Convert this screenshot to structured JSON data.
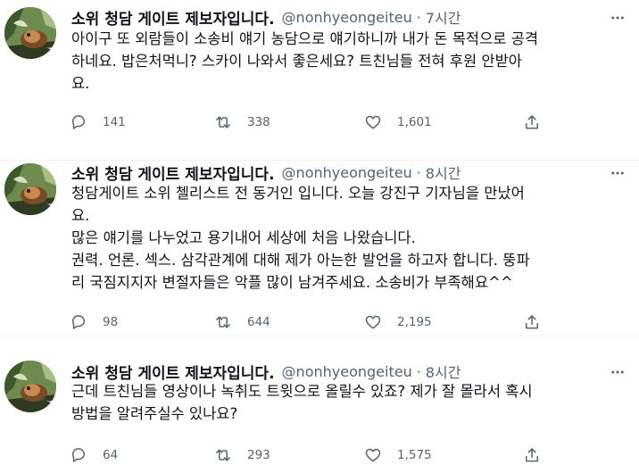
{
  "tweets": [
    {
      "name": "소위 청담 게이트 제보자입니다.",
      "handle": "@nonhyeongeiteu",
      "dot": "·",
      "time": "7시간",
      "lines": [
        "아이구 또 외람들이 소송비 얘기 농담으로 얘기하니까 내가 돈 목적으로 공격",
        "하네요.  밥은처먹니? 스카이 나와서 좋은세요? 트친님들 전혀 후원 안받아",
        "요."
      ],
      "replies": "141",
      "retweets": "338",
      "likes": "1,601"
    },
    {
      "name": "소위 청담 게이트 제보자입니다.",
      "handle": "@nonhyeongeiteu",
      "dot": "·",
      "time": "8시간",
      "lines": [
        "청담게이트 소위 첼리스트 전 동거인 입니다. 오늘 강진구 기자님을 만났어",
        "요.",
        "많은 얘기를 나누었고 용기내어 세상에 처음 나왔습니다.",
        "권력. 언론. 섹스.  삼각관계에 대해 제가 아는한 발언을 하고자 합니다. 뚱파",
        "리 국짐지지자 변절자들은 악플 많이 남겨주세요. 소송비가 부족해요^^"
      ],
      "replies": "98",
      "retweets": "644",
      "likes": "2,195"
    },
    {
      "name": "소위 청담 게이트 제보자입니다.",
      "handle": "@nonhyeongeiteu",
      "dot": "·",
      "time": "8시간",
      "lines": [
        "근데 트친님들 영상이나 녹취도 트윗으로 올릴수 있죠? 제가 잘 몰라서 혹시",
        "방법을 알려주실수 있나요?"
      ],
      "replies": "64",
      "retweets": "293",
      "likes": "1,575"
    }
  ],
  "icons": {
    "reply": "reply-icon",
    "retweet": "retweet-icon",
    "like": "heart-icon",
    "share": "share-icon",
    "more": "more-options-icon"
  },
  "colors": {
    "text": "#0f1419",
    "secondary": "#536471",
    "divider": "#eff3f4"
  }
}
